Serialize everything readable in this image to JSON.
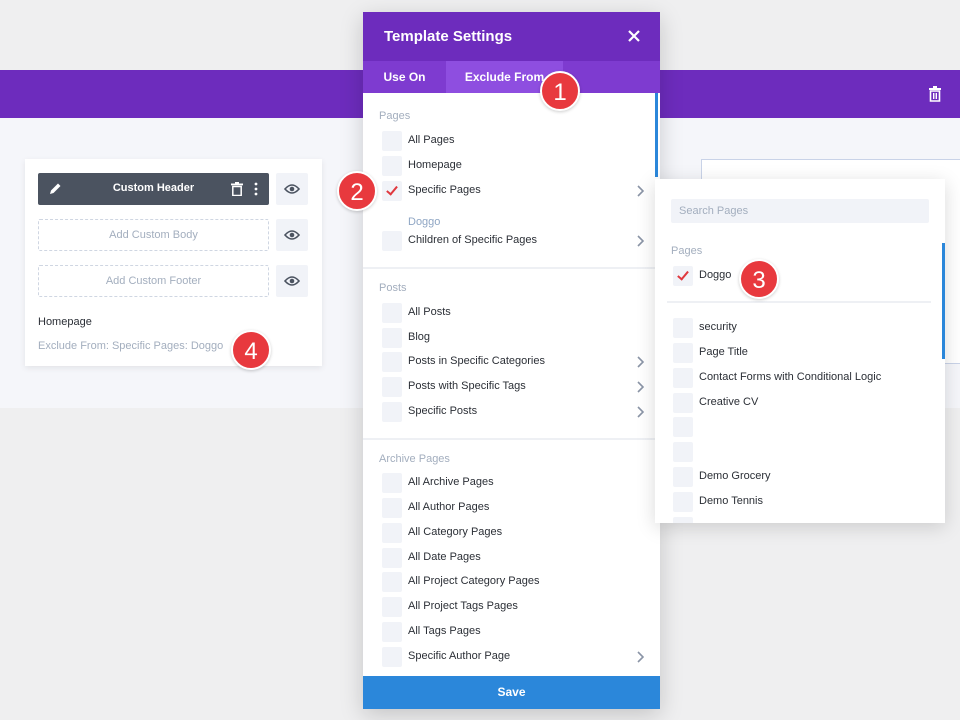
{
  "colors": {
    "purple": "#6d2cbd",
    "accent_blue": "#2b87da",
    "badge_red": "#e8393e",
    "check_red": "#e0383e"
  },
  "template_card": {
    "header_label": "Custom Header",
    "body_label": "Add Custom Body",
    "footer_label": "Add Custom Footer",
    "title": "Homepage",
    "summary": "Exclude From: Specific Pages: Doggo"
  },
  "modal": {
    "title": "Template Settings",
    "tabs": [
      {
        "label": "Use On"
      },
      {
        "label": "Exclude From"
      }
    ],
    "sections": {
      "pages": {
        "title": "Pages",
        "items": [
          {
            "label": "All Pages"
          },
          {
            "label": "Homepage"
          },
          {
            "label": "Specific Pages",
            "checked": true,
            "sub_value": "Doggo"
          },
          {
            "label": "Children of Specific Pages"
          }
        ]
      },
      "posts": {
        "title": "Posts",
        "items": [
          {
            "label": "All Posts"
          },
          {
            "label": "Blog"
          },
          {
            "label": "Posts in Specific Categories"
          },
          {
            "label": "Posts with Specific Tags"
          },
          {
            "label": "Specific Posts"
          }
        ]
      },
      "archive": {
        "title": "Archive Pages",
        "items": [
          {
            "label": "All Archive Pages"
          },
          {
            "label": "All Author Pages"
          },
          {
            "label": "All Category Pages"
          },
          {
            "label": "All Date Pages"
          },
          {
            "label": "All Project Category Pages"
          },
          {
            "label": "All Project Tags Pages"
          },
          {
            "label": "All Tags Pages"
          },
          {
            "label": "Specific Author Page"
          }
        ]
      }
    },
    "save_label": "Save"
  },
  "side_panel": {
    "search_placeholder": "Search Pages",
    "section_title": "Pages",
    "selected": [
      {
        "label": "Doggo",
        "checked": true
      }
    ],
    "items": [
      {
        "label": "security"
      },
      {
        "label": "Page Title"
      },
      {
        "label": "Contact Forms with Conditional Logic"
      },
      {
        "label": "Creative CV"
      },
      {
        "label": ""
      },
      {
        "label": ""
      },
      {
        "label": "Demo Grocery"
      },
      {
        "label": "Demo Tennis"
      }
    ]
  },
  "badges": [
    "1",
    "2",
    "3",
    "4"
  ]
}
